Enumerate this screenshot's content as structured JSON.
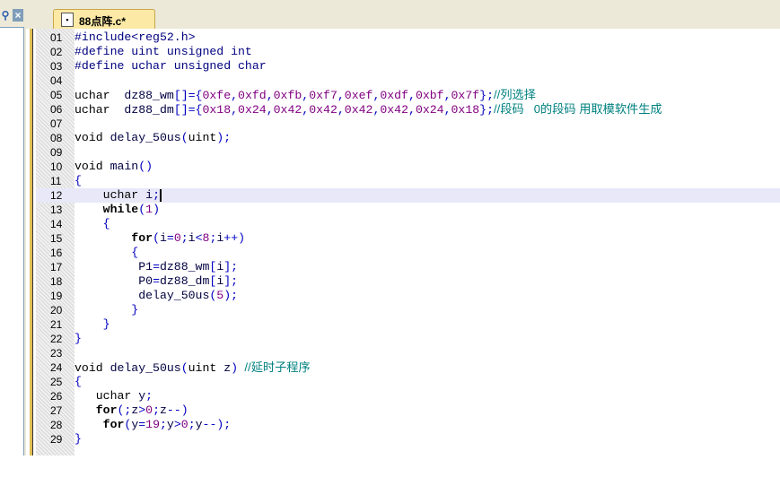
{
  "tab": {
    "label": "88点阵.c*"
  },
  "left_panel": {
    "icons": [
      "pin-icon",
      "close-icon"
    ]
  },
  "code": {
    "cursor_line": 12,
    "lines": [
      {
        "n": "01",
        "tokens": [
          [
            "pp",
            "#include<reg52.h>"
          ]
        ]
      },
      {
        "n": "02",
        "tokens": [
          [
            "pp",
            "#define uint unsigned int"
          ]
        ]
      },
      {
        "n": "03",
        "tokens": [
          [
            "pp",
            "#define uchar unsigned char"
          ]
        ]
      },
      {
        "n": "04",
        "tokens": []
      },
      {
        "n": "05",
        "tokens": [
          [
            "kw",
            "uchar"
          ],
          [
            "id",
            "  dz88_wm"
          ],
          [
            "p",
            "[]={"
          ],
          [
            "num",
            "0xfe"
          ],
          [
            "p",
            ","
          ],
          [
            "num",
            "0xfd"
          ],
          [
            "p",
            ","
          ],
          [
            "num",
            "0xfb"
          ],
          [
            "p",
            ","
          ],
          [
            "num",
            "0xf7"
          ],
          [
            "p",
            ","
          ],
          [
            "num",
            "0xef"
          ],
          [
            "p",
            ","
          ],
          [
            "num",
            "0xdf"
          ],
          [
            "p",
            ","
          ],
          [
            "num",
            "0xbf"
          ],
          [
            "p",
            ","
          ],
          [
            "num",
            "0x7f"
          ],
          [
            "p",
            "};"
          ],
          [
            "cm",
            "//列选择"
          ]
        ]
      },
      {
        "n": "06",
        "tokens": [
          [
            "kw",
            "uchar"
          ],
          [
            "id",
            "  dz88_dm"
          ],
          [
            "p",
            "[]={"
          ],
          [
            "num",
            "0x18"
          ],
          [
            "p",
            ","
          ],
          [
            "num",
            "0x24"
          ],
          [
            "p",
            ","
          ],
          [
            "num",
            "0x42"
          ],
          [
            "p",
            ","
          ],
          [
            "num",
            "0x42"
          ],
          [
            "p",
            ","
          ],
          [
            "num",
            "0x42"
          ],
          [
            "p",
            ","
          ],
          [
            "num",
            "0x42"
          ],
          [
            "p",
            ","
          ],
          [
            "num",
            "0x24"
          ],
          [
            "p",
            ","
          ],
          [
            "num",
            "0x18"
          ],
          [
            "p",
            "};"
          ],
          [
            "cm",
            "//段码   0的段码 用取模软件生成"
          ]
        ]
      },
      {
        "n": "07",
        "tokens": []
      },
      {
        "n": "08",
        "tokens": [
          [
            "kw",
            "void"
          ],
          [
            "id",
            " delay_50us"
          ],
          [
            "p",
            "("
          ],
          [
            "kw",
            "uint"
          ],
          [
            "p",
            ");"
          ]
        ]
      },
      {
        "n": "09",
        "tokens": []
      },
      {
        "n": "10",
        "tokens": [
          [
            "kw",
            "void"
          ],
          [
            "id",
            " main"
          ],
          [
            "p",
            "()"
          ]
        ]
      },
      {
        "n": "11",
        "tokens": [
          [
            "p",
            "{"
          ]
        ]
      },
      {
        "n": "12",
        "tokens": [
          [
            "kw",
            "    uchar"
          ],
          [
            "id",
            " i"
          ],
          [
            "p",
            ";"
          ]
        ]
      },
      {
        "n": "13",
        "tokens": [
          [
            "kwb",
            "    while"
          ],
          [
            "p",
            "("
          ],
          [
            "num",
            "1"
          ],
          [
            "p",
            ")"
          ]
        ]
      },
      {
        "n": "14",
        "tokens": [
          [
            "p",
            "    {"
          ]
        ]
      },
      {
        "n": "15",
        "tokens": [
          [
            "kwb",
            "        for"
          ],
          [
            "p",
            "("
          ],
          [
            "id",
            "i"
          ],
          [
            "p",
            "="
          ],
          [
            "num",
            "0"
          ],
          [
            "p",
            ";"
          ],
          [
            "id",
            "i"
          ],
          [
            "p",
            "<"
          ],
          [
            "num",
            "8"
          ],
          [
            "p",
            ";"
          ],
          [
            "id",
            "i"
          ],
          [
            "p",
            "++)"
          ]
        ]
      },
      {
        "n": "16",
        "tokens": [
          [
            "p",
            "        {"
          ]
        ]
      },
      {
        "n": "17",
        "tokens": [
          [
            "id",
            "         P1"
          ],
          [
            "p",
            "="
          ],
          [
            "id",
            "dz88_wm"
          ],
          [
            "p",
            "["
          ],
          [
            "id",
            "i"
          ],
          [
            "p",
            "];"
          ]
        ]
      },
      {
        "n": "18",
        "tokens": [
          [
            "id",
            "         P0"
          ],
          [
            "p",
            "="
          ],
          [
            "id",
            "dz88_dm"
          ],
          [
            "p",
            "["
          ],
          [
            "id",
            "i"
          ],
          [
            "p",
            "];"
          ]
        ]
      },
      {
        "n": "19",
        "tokens": [
          [
            "id",
            "         delay_50us"
          ],
          [
            "p",
            "("
          ],
          [
            "num",
            "5"
          ],
          [
            "p",
            ");"
          ]
        ]
      },
      {
        "n": "20",
        "tokens": [
          [
            "p",
            "        }"
          ]
        ]
      },
      {
        "n": "21",
        "tokens": [
          [
            "p",
            "    }"
          ]
        ]
      },
      {
        "n": "22",
        "tokens": [
          [
            "p",
            "}"
          ]
        ]
      },
      {
        "n": "23",
        "tokens": []
      },
      {
        "n": "24",
        "tokens": [
          [
            "kw",
            "void"
          ],
          [
            "id",
            " delay_50us"
          ],
          [
            "p",
            "("
          ],
          [
            "kw",
            "uint"
          ],
          [
            "id",
            " z"
          ],
          [
            "p",
            ")"
          ],
          [
            "cm",
            "  //延时子程序"
          ]
        ]
      },
      {
        "n": "25",
        "tokens": [
          [
            "p",
            "{"
          ]
        ]
      },
      {
        "n": "26",
        "tokens": [
          [
            "kw",
            "   uchar"
          ],
          [
            "id",
            " y"
          ],
          [
            "p",
            ";"
          ]
        ]
      },
      {
        "n": "27",
        "tokens": [
          [
            "kwb",
            "   for"
          ],
          [
            "p",
            "(;"
          ],
          [
            "id",
            "z"
          ],
          [
            "p",
            ">"
          ],
          [
            "num",
            "0"
          ],
          [
            "p",
            ";"
          ],
          [
            "id",
            "z"
          ],
          [
            "p",
            "--)"
          ]
        ]
      },
      {
        "n": "28",
        "tokens": [
          [
            "kwb",
            "    for"
          ],
          [
            "p",
            "("
          ],
          [
            "id",
            "y"
          ],
          [
            "p",
            "="
          ],
          [
            "num",
            "19"
          ],
          [
            "p",
            ";"
          ],
          [
            "id",
            "y"
          ],
          [
            "p",
            ">"
          ],
          [
            "num",
            "0"
          ],
          [
            "p",
            ";"
          ],
          [
            "id",
            "y"
          ],
          [
            "p",
            "--);"
          ]
        ]
      },
      {
        "n": "29",
        "tokens": [
          [
            "p",
            "}"
          ]
        ]
      }
    ]
  }
}
